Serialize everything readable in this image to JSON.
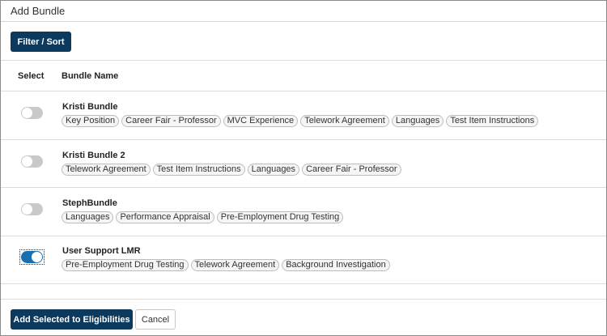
{
  "dialog": {
    "title": "Add Bundle"
  },
  "toolbar": {
    "filter_sort_label": "Filter / Sort"
  },
  "table": {
    "headers": {
      "select": "Select",
      "bundle_name": "Bundle Name"
    },
    "rows": [
      {
        "name": "Kristi Bundle",
        "selected": false,
        "tags": [
          "Key Position",
          "Career Fair - Professor",
          "MVC Experience",
          "Telework Agreement",
          "Languages",
          "Test Item Instructions"
        ]
      },
      {
        "name": "Kristi Bundle 2",
        "selected": false,
        "tags": [
          "Telework Agreement",
          "Test Item Instructions",
          "Languages",
          "Career Fair - Professor"
        ]
      },
      {
        "name": "StephBundle",
        "selected": false,
        "tags": [
          "Languages",
          "Performance Appraisal",
          "Pre-Employment Drug Testing"
        ]
      },
      {
        "name": "User Support LMR",
        "selected": true,
        "tags": [
          "Pre-Employment Drug Testing",
          "Telework Agreement",
          "Background Investigation"
        ]
      }
    ]
  },
  "footer": {
    "add_label": "Add Selected to Eligibilities",
    "cancel_label": "Cancel"
  },
  "colors": {
    "primary": "#0c3a5e",
    "toggle_on": "#1a6fb0",
    "toggle_off": "#c9c9c9"
  }
}
